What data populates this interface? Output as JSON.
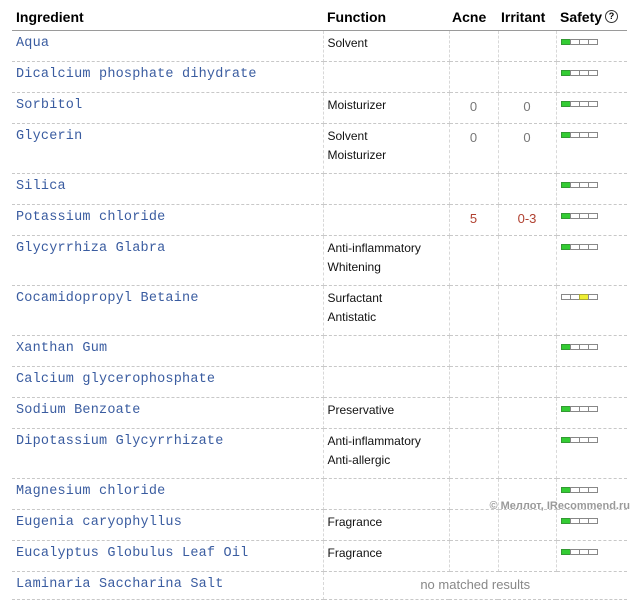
{
  "headers": {
    "ingredient": "Ingredient",
    "function": "Function",
    "acne": "Acne",
    "irritant": "Irritant",
    "safety": "Safety",
    "help_icon": "question-circle-icon"
  },
  "colors": {
    "ingredient_link": "#3a5ca0",
    "meter_green": "#33cc33",
    "meter_yellow": "#eeee33",
    "highlight_number": "#b04030"
  },
  "rows": [
    {
      "name": "Aqua",
      "functions": [
        "Solvent"
      ],
      "acne": "",
      "irritant": "",
      "safety": [
        "g",
        "",
        "",
        ""
      ]
    },
    {
      "name": "Dicalcium phosphate dihydrate",
      "functions": [],
      "acne": "",
      "irritant": "",
      "safety": [
        "g",
        "",
        "",
        ""
      ]
    },
    {
      "name": "Sorbitol",
      "functions": [
        "Moisturizer"
      ],
      "acne": "0",
      "irritant": "0",
      "safety": [
        "g",
        "",
        "",
        ""
      ]
    },
    {
      "name": "Glycerin",
      "functions": [
        "Solvent",
        "Moisturizer"
      ],
      "acne": "0",
      "irritant": "0",
      "safety": [
        "g",
        "",
        "",
        ""
      ]
    },
    {
      "name": "Silica",
      "functions": [],
      "acne": "",
      "irritant": "",
      "safety": [
        "g",
        "",
        "",
        ""
      ]
    },
    {
      "name": "Potassium chloride",
      "functions": [],
      "acne": "5",
      "irritant": "0-3",
      "safety": [
        "g",
        "",
        "",
        ""
      ]
    },
    {
      "name": "Glycyrrhiza Glabra",
      "functions": [
        "Anti-inflammatory",
        "Whitening"
      ],
      "acne": "",
      "irritant": "",
      "safety": [
        "g",
        "",
        "",
        ""
      ]
    },
    {
      "name": "Cocamidopropyl Betaine",
      "functions": [
        "Surfactant",
        "Antistatic"
      ],
      "acne": "",
      "irritant": "",
      "safety": [
        "",
        "",
        "y",
        ""
      ]
    },
    {
      "name": "Xanthan Gum",
      "functions": [],
      "acne": "",
      "irritant": "",
      "safety": [
        "g",
        "",
        "",
        ""
      ]
    },
    {
      "name": "Calcium glycerophosphate",
      "functions": [],
      "acne": "",
      "irritant": "",
      "safety": null
    },
    {
      "name": "Sodium Benzoate",
      "functions": [
        "Preservative"
      ],
      "acne": "",
      "irritant": "",
      "safety": [
        "g",
        "",
        "",
        ""
      ]
    },
    {
      "name": "Dipotassium Glycyrrhizate",
      "functions": [
        "Anti-inflammatory",
        "Anti-allergic"
      ],
      "acne": "",
      "irritant": "",
      "safety": [
        "g",
        "",
        "",
        ""
      ]
    },
    {
      "name": "Magnesium chloride",
      "functions": [],
      "acne": "",
      "irritant": "",
      "safety": [
        "g",
        "",
        "",
        ""
      ]
    },
    {
      "name": "Eugenia caryophyllus",
      "functions": [
        "Fragrance"
      ],
      "acne": "",
      "irritant": "",
      "safety": [
        "g",
        "",
        "",
        ""
      ]
    },
    {
      "name": "Eucalyptus Globulus Leaf Oil",
      "functions": [
        "Fragrance"
      ],
      "acne": "",
      "irritant": "",
      "safety": [
        "g",
        "",
        "",
        ""
      ]
    },
    {
      "name": "Laminaria Saccharina Salt",
      "functions": [],
      "acne": "",
      "irritant": "",
      "safety": null,
      "no_match": "no matched results"
    }
  ],
  "watermark": "© Меллот, IRecommend.ru"
}
